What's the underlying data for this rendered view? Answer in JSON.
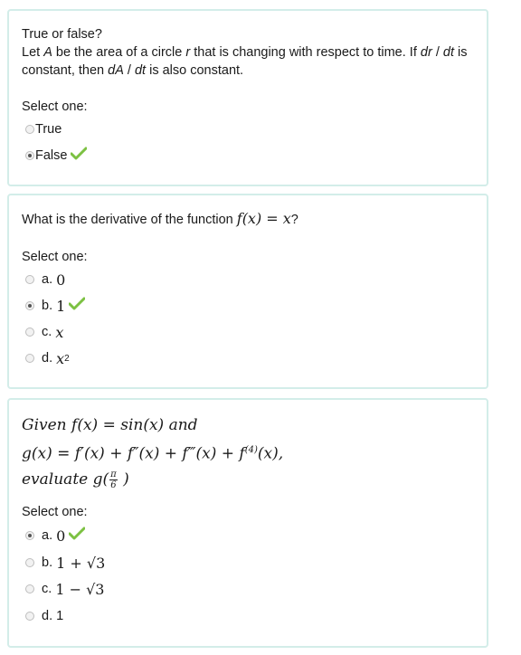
{
  "q1": {
    "title": "True or false?",
    "line1_a": "Let ",
    "line1_A": "A",
    "line1_b": " be the area of a circle ",
    "line1_r": "r",
    "line1_c": " that is changing with respect to time. If ",
    "line1_dr": "dr",
    "line1_slash": " / ",
    "line1_dt": "dt",
    "line1_d": " is",
    "line2_a": "constant, then ",
    "line2_dA": "dA",
    "line2_slash": " / ",
    "line2_dt": "dt",
    "line2_b": " is also constant.",
    "select_label": "Select one:",
    "options": [
      {
        "label": "True",
        "checked": false,
        "correct": false
      },
      {
        "label": "False",
        "checked": true,
        "correct": true
      }
    ]
  },
  "q2": {
    "text_a": "What is the derivative of the function ",
    "math": "f(x) = x",
    "text_b": "?",
    "select_label": "Select one:",
    "options": [
      {
        "letter": "a.",
        "value": "0",
        "checked": false,
        "correct": false
      },
      {
        "letter": "b.",
        "value": "1",
        "checked": true,
        "correct": true
      },
      {
        "letter": "c.",
        "value": "x",
        "checked": false,
        "correct": false
      },
      {
        "letter": "d.",
        "value": "x",
        "sup": "2",
        "checked": false,
        "correct": false
      }
    ]
  },
  "q3": {
    "line1": "Given f(x) = sin(x) and",
    "line2": "g(x) = f′(x) + f″(x) + f‴(x) + f",
    "line2_sup": "(4)",
    "line2_end": "(x),",
    "line3": "evaluate g(",
    "frac_num": "π",
    "frac_den": "6",
    "line3_end": " )",
    "select_label": "Select one:",
    "options": [
      {
        "letter": "a.",
        "value": "0",
        "checked": true,
        "correct": true
      },
      {
        "letter": "b.",
        "value": "1 + √3",
        "checked": false,
        "correct": false
      },
      {
        "letter": "c.",
        "value": "1 − √3",
        "checked": false,
        "correct": false
      },
      {
        "letter": "d.",
        "value": "1",
        "checked": false,
        "correct": false
      }
    ]
  },
  "colors": {
    "card_border": "#d3ede9",
    "check": "#7cc142"
  }
}
